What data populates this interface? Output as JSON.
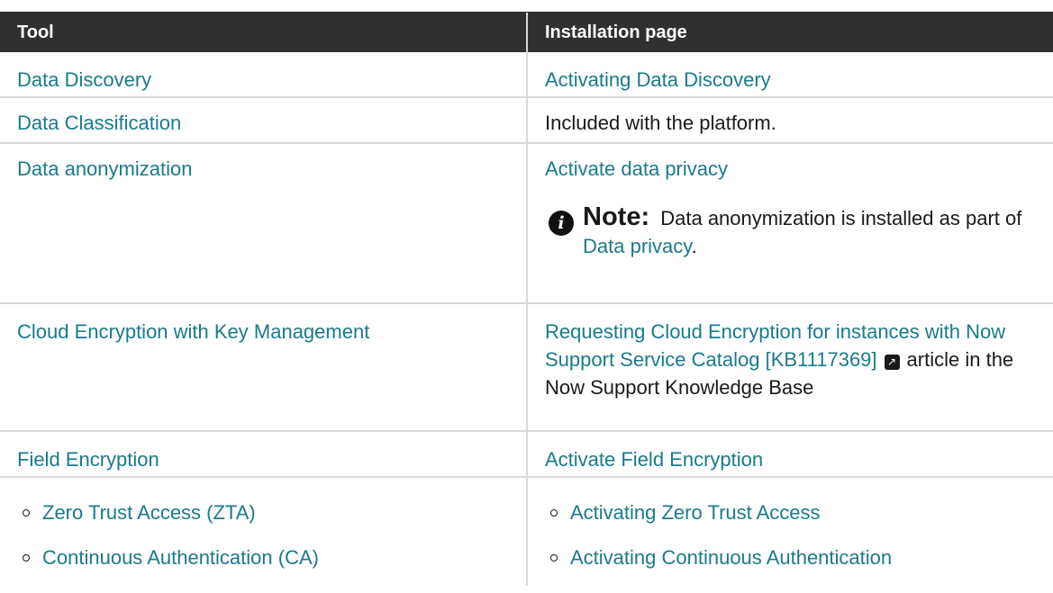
{
  "header": {
    "tool": "Tool",
    "installation": "Installation page"
  },
  "rows": [
    {
      "tool": "Data Discovery",
      "install": "Activating Data Discovery"
    },
    {
      "tool": "Data Classification",
      "install": "Included with the platform."
    },
    {
      "tool": "Data anonymization",
      "install": "Activate data privacy",
      "note": {
        "label": "Note:",
        "text_before": "Data anonymization is installed as part of",
        "link": "Data privacy",
        "text_after": ".",
        "icon": "info-icon"
      }
    },
    {
      "tool": "Cloud Encryption with Key Management",
      "install_link": "Requesting Cloud Encryption for instances with Now Support Service Catalog [KB1117369]",
      "install_suffix": "article in the Now Support Knowledge Base",
      "icon": "external-link-icon"
    },
    {
      "tool": "Field Encryption",
      "install": "Activate Field Encryption"
    },
    {
      "tool_items": [
        "Zero Trust Access (ZTA)",
        "Continuous Authentication (CA)"
      ],
      "install_items": [
        "Activating Zero Trust Access",
        "Activating Continuous Authentication"
      ]
    }
  ],
  "colors": {
    "header_bg": "#303030",
    "link": "#1a7a8c",
    "border": "#d9d9d9"
  }
}
